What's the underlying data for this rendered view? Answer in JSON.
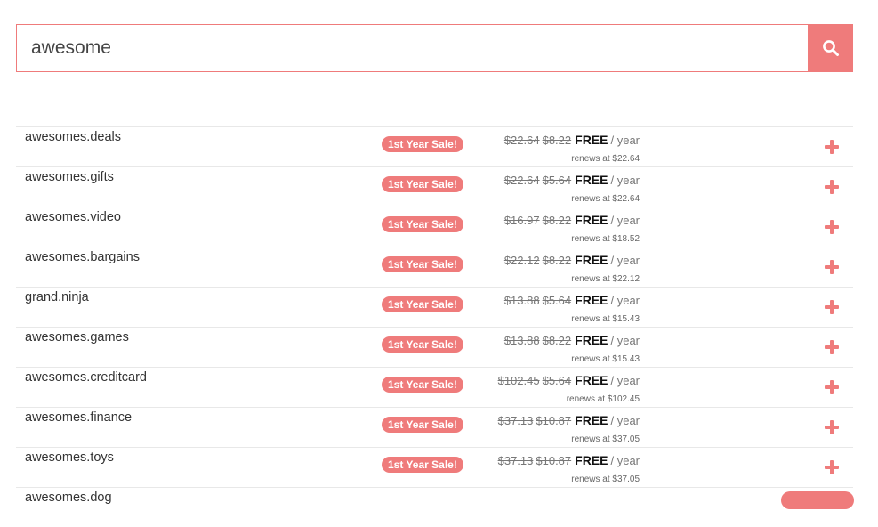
{
  "search": {
    "value": "awesome",
    "button_icon": "search-icon"
  },
  "results": [
    {
      "domain": "awesomes.deals",
      "badge": "1st Year Sale!",
      "old_price_1": "$22.64",
      "old_price_2": "$8.22",
      "free": "FREE",
      "per": "/ year",
      "renews": "renews at $22.64"
    },
    {
      "domain": "awesomes.gifts",
      "badge": "1st Year Sale!",
      "old_price_1": "$22.64",
      "old_price_2": "$5.64",
      "free": "FREE",
      "per": "/ year",
      "renews": "renews at $22.64"
    },
    {
      "domain": "awesomes.video",
      "badge": "1st Year Sale!",
      "old_price_1": "$16.97",
      "old_price_2": "$8.22",
      "free": "FREE",
      "per": "/ year",
      "renews": "renews at $18.52"
    },
    {
      "domain": "awesomes.bargains",
      "badge": "1st Year Sale!",
      "old_price_1": "$22.12",
      "old_price_2": "$8.22",
      "free": "FREE",
      "per": "/ year",
      "renews": "renews at $22.12"
    },
    {
      "domain": "grand.ninja",
      "badge": "1st Year Sale!",
      "old_price_1": "$13.88",
      "old_price_2": "$5.64",
      "free": "FREE",
      "per": "/ year",
      "renews": "renews at $15.43"
    },
    {
      "domain": "awesomes.games",
      "badge": "1st Year Sale!",
      "old_price_1": "$13.88",
      "old_price_2": "$8.22",
      "free": "FREE",
      "per": "/ year",
      "renews": "renews at $15.43"
    },
    {
      "domain": "awesomes.creditcard",
      "badge": "1st Year Sale!",
      "old_price_1": "$102.45",
      "old_price_2": "$5.64",
      "free": "FREE",
      "per": "/ year",
      "renews": "renews at $102.45"
    },
    {
      "domain": "awesomes.finance",
      "badge": "1st Year Sale!",
      "old_price_1": "$37.13",
      "old_price_2": "$10.87",
      "free": "FREE",
      "per": "/ year",
      "renews": "renews at $37.05"
    },
    {
      "domain": "awesomes.toys",
      "badge": "1st Year Sale!",
      "old_price_1": "$37.13",
      "old_price_2": "$10.87",
      "free": "FREE",
      "per": "/ year",
      "renews": "renews at $37.05"
    },
    {
      "domain": "awesomes.dog",
      "badge": "",
      "old_price_1": "",
      "old_price_2": "",
      "free": "",
      "per": "",
      "renews": ""
    }
  ],
  "colors": {
    "accent": "#ef7b7b",
    "text": "#333333",
    "muted": "#777777",
    "divider": "#e8e8e8"
  },
  "icons": {
    "add": "plus-icon",
    "search": "search-icon"
  }
}
